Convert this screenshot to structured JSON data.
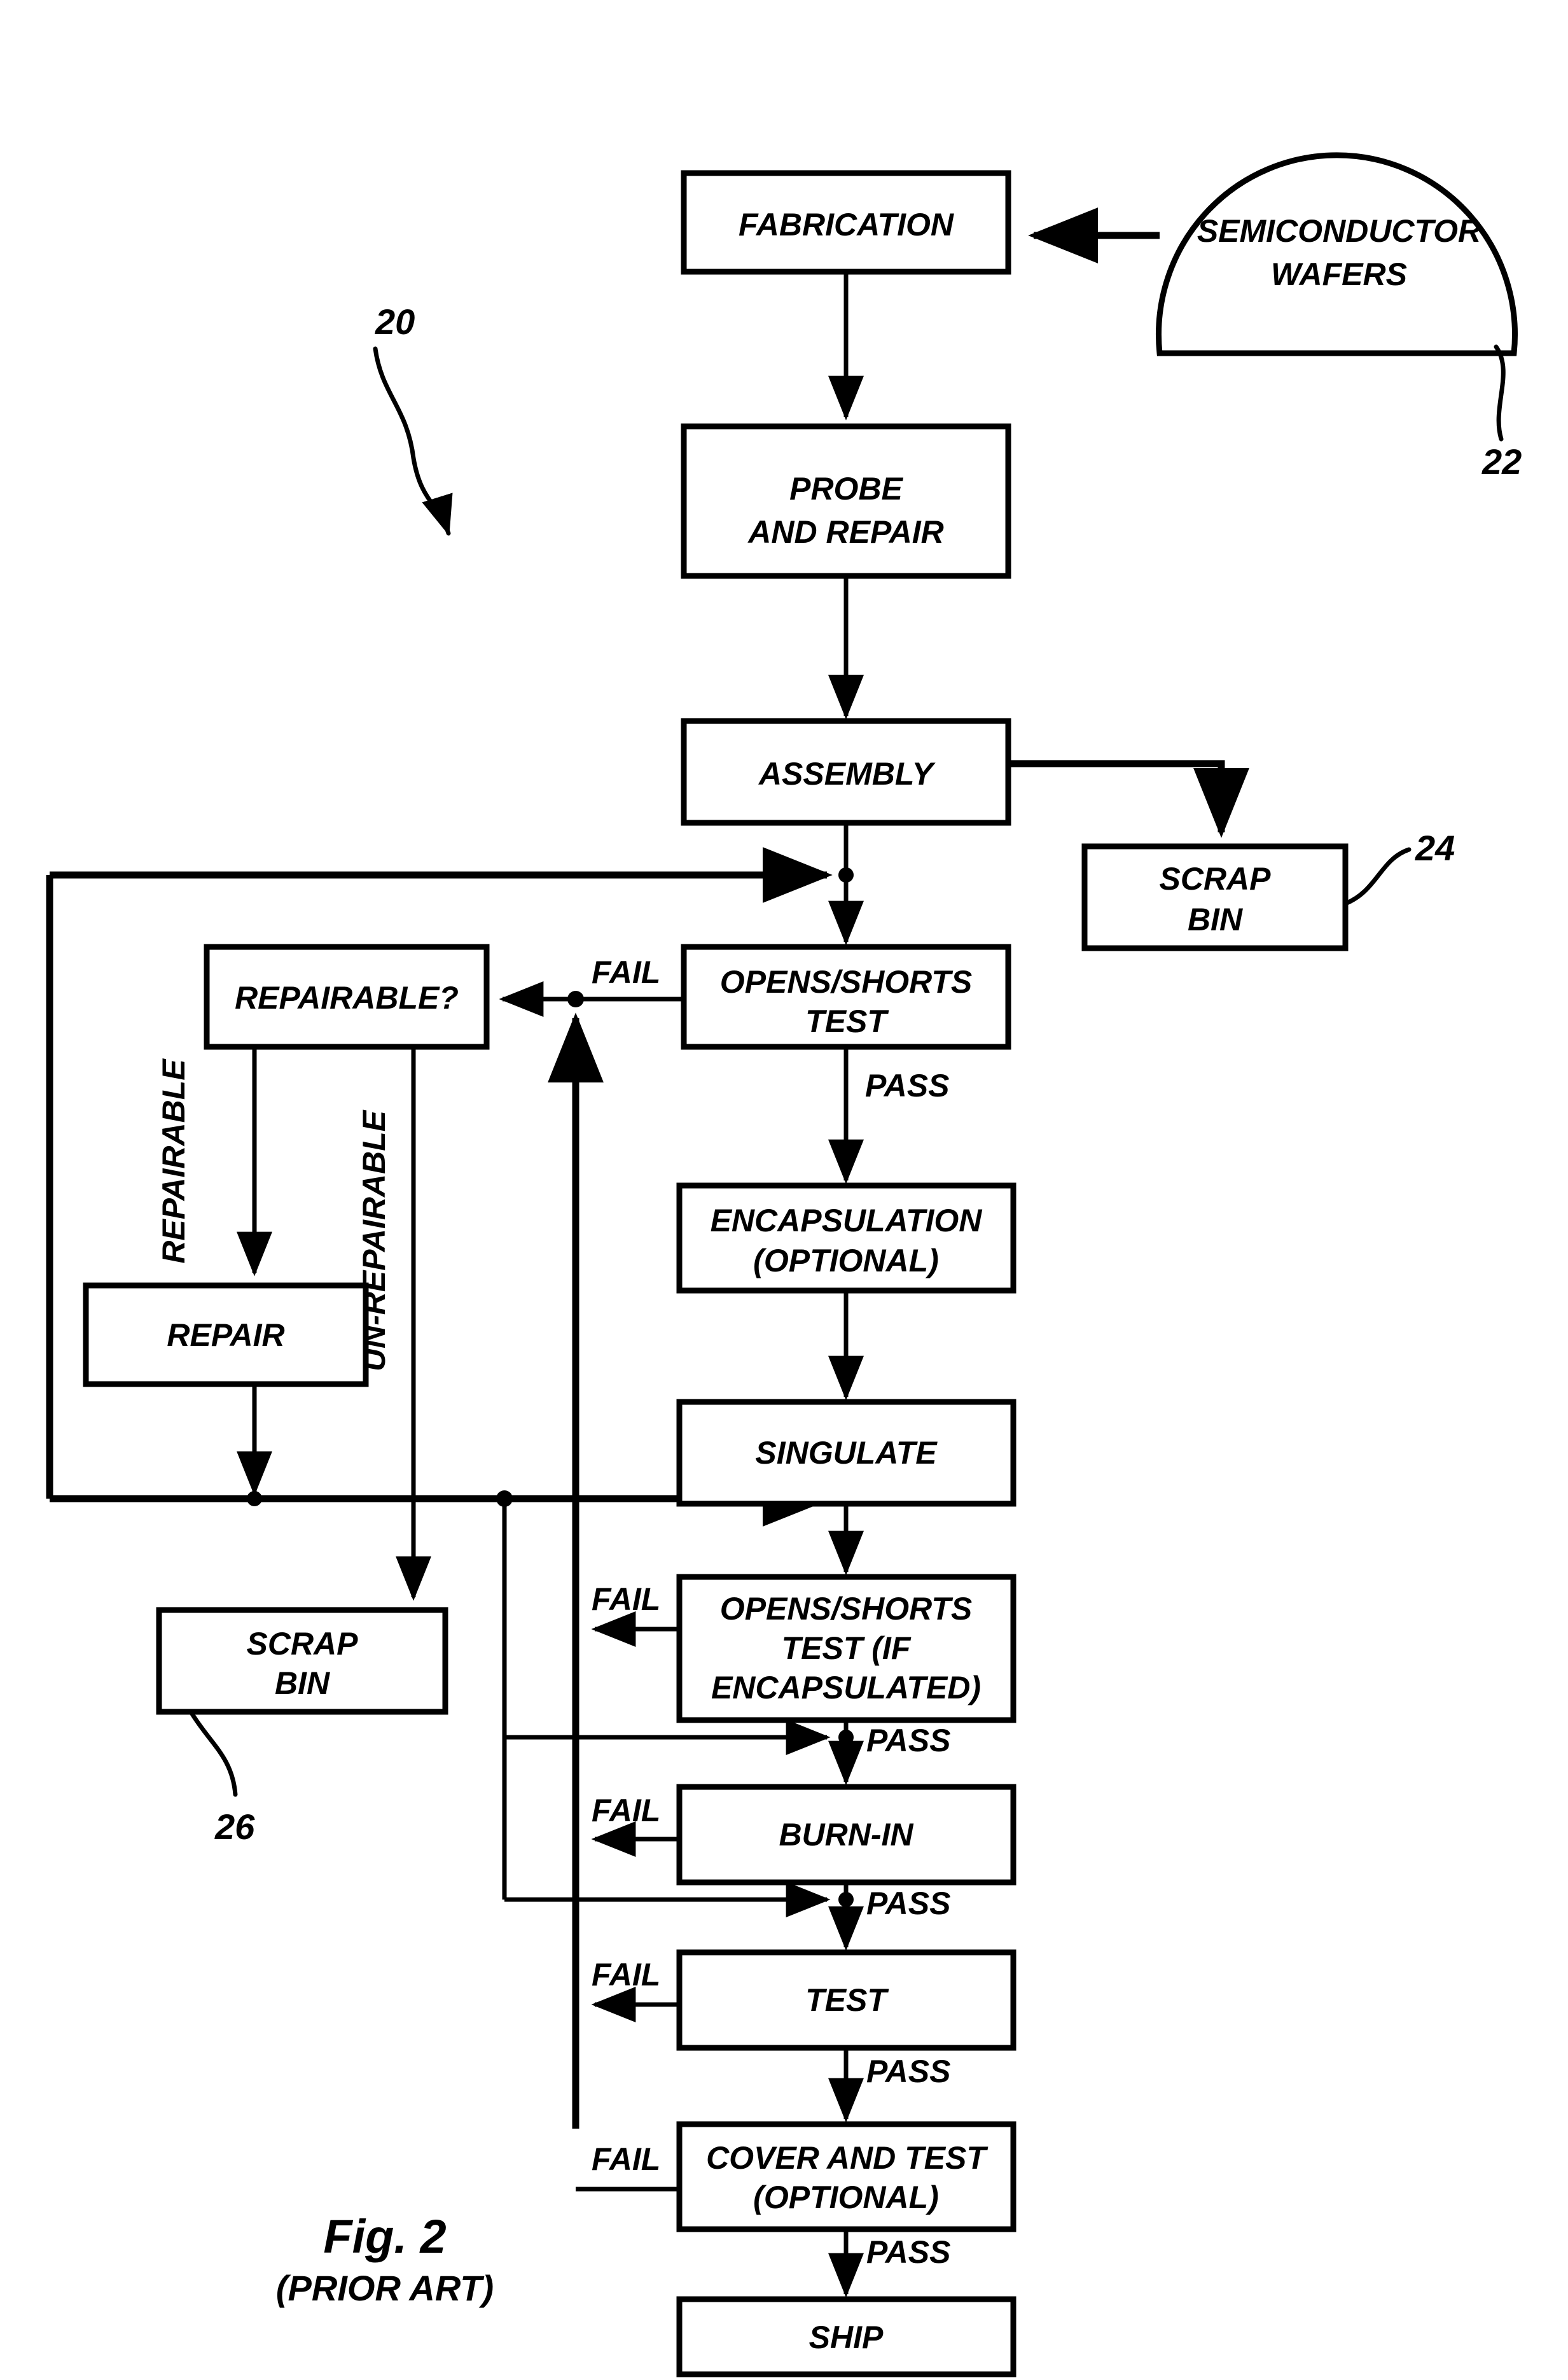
{
  "figure": {
    "caption": "Fig. 2",
    "caption_sub": "(PRIOR ART)",
    "reference_numerals": [
      {
        "id": "ref-20",
        "label": "20"
      },
      {
        "id": "ref-22",
        "label": "22"
      },
      {
        "id": "ref-24",
        "label": "24"
      },
      {
        "id": "ref-26",
        "label": "26"
      }
    ]
  },
  "nodes": {
    "wafers_line1": "SEMICONDUCTOR",
    "wafers_line2": "WAFERS",
    "fabrication": "FABRICATION",
    "probe_line1": "PROBE",
    "probe_line2": "AND REPAIR",
    "assembly": "ASSEMBLY",
    "scrap_bin_24_line1": "SCRAP",
    "scrap_bin_24_line2": "BIN",
    "opens_shorts_line1": "OPENS/SHORTS",
    "opens_shorts_line2": "TEST",
    "repairable": "REPAIRABLE?",
    "repair": "REPAIR",
    "scrap_bin_26_line1": "SCRAP",
    "scrap_bin_26_line2": "BIN",
    "encapsulation_line1": "ENCAPSULATION",
    "encapsulation_line2": "(OPTIONAL)",
    "singulate": "SINGULATE",
    "opens_shorts_enc_line1": "OPENS/SHORTS",
    "opens_shorts_enc_line2": "TEST (IF",
    "opens_shorts_enc_line3": "ENCAPSULATED)",
    "burn_in": "BURN-IN",
    "test": "TEST",
    "cover_test_line1": "COVER AND TEST",
    "cover_test_line2": "(OPTIONAL)",
    "ship": "SHIP"
  },
  "edge_labels": {
    "fail_1": "FAIL",
    "pass_1": "PASS",
    "repairable_branch": "REPAIRABLE",
    "unrepairable_branch": "UN-REPAIRABLE",
    "fail_2": "FAIL",
    "pass_2": "PASS",
    "fail_3": "FAIL",
    "pass_3": "PASS",
    "fail_4": "FAIL",
    "pass_4": "PASS",
    "fail_5": "FAIL",
    "pass_5": "PASS"
  },
  "colors": {
    "ink": "#000000",
    "paper": "#ffffff"
  }
}
